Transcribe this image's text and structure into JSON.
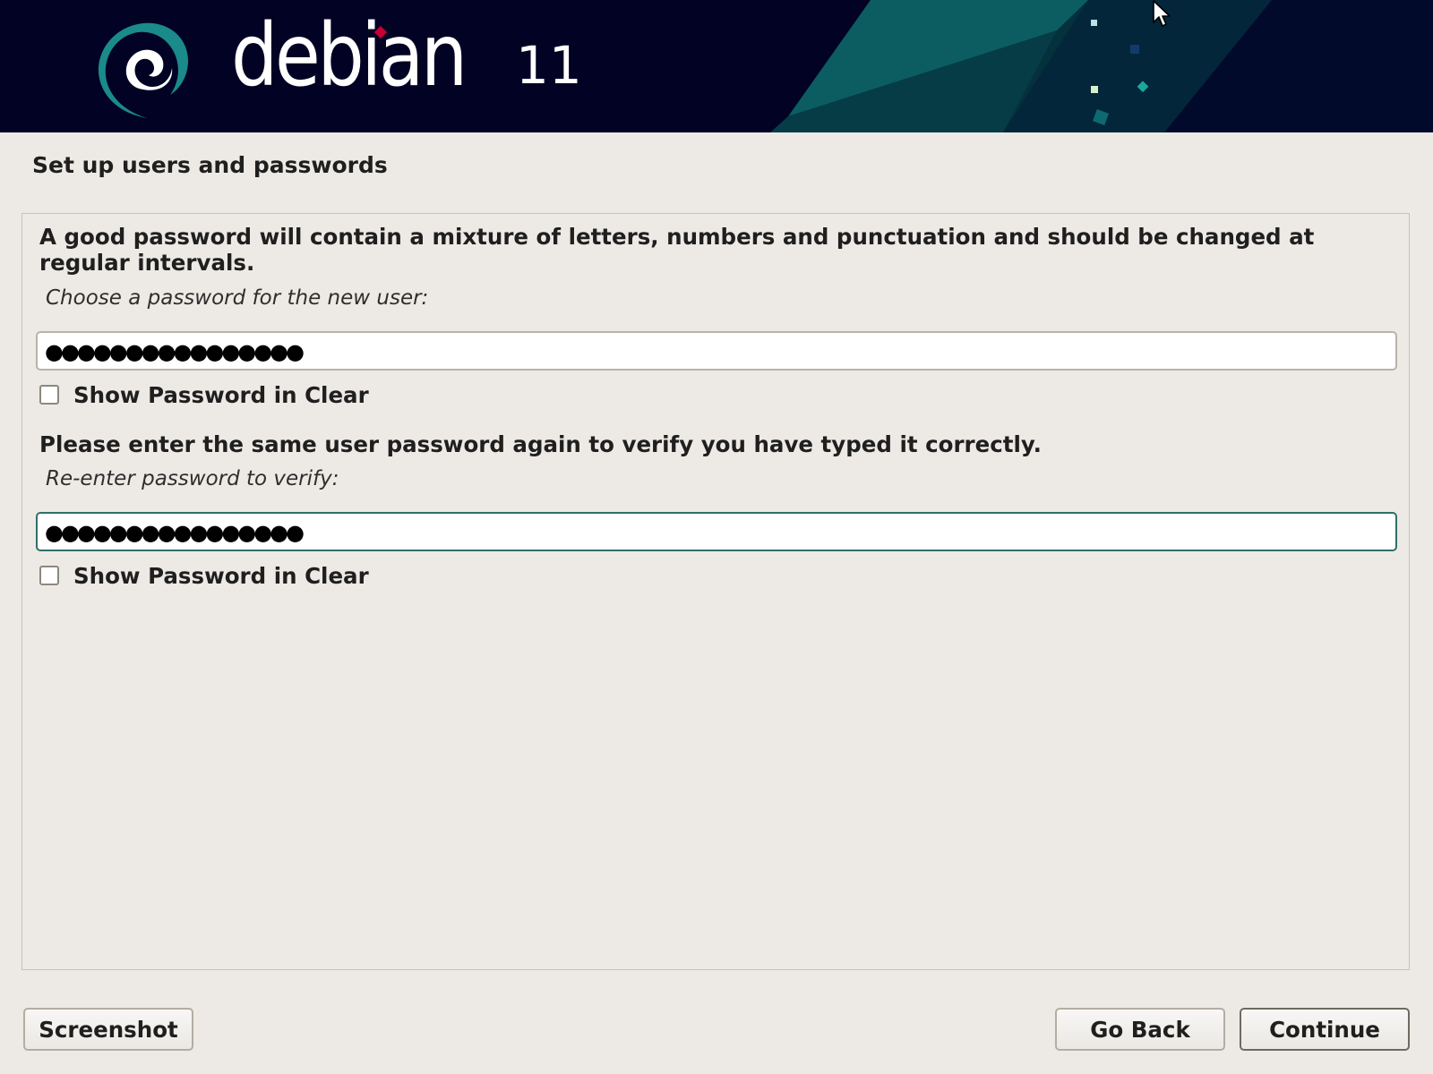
{
  "banner": {
    "product_name": "debian",
    "version": "11",
    "logo_icon": "debian-swirl-icon",
    "colors": {
      "background": "#020324",
      "accent_teal": "#0e6b6a",
      "logo_red": "#c70036"
    }
  },
  "step_title": "Set up users and passwords",
  "password_section": {
    "instruction": "A good password will contain a mixture of letters, numbers and punctuation and should be changed at regular intervals.",
    "prompt": "Choose a password for the new user:",
    "masked_value": "●●●●●●●●●●●●●●●●",
    "show_clear_label": "Show Password in Clear"
  },
  "verify_section": {
    "instruction": "Please enter the same user password again to verify you have typed it correctly.",
    "prompt": "Re-enter password to verify:",
    "masked_value": "●●●●●●●●●●●●●●●●",
    "show_clear_label": "Show Password in Clear"
  },
  "buttons": {
    "screenshot": "Screenshot",
    "go_back": "Go Back",
    "continue": "Continue"
  }
}
